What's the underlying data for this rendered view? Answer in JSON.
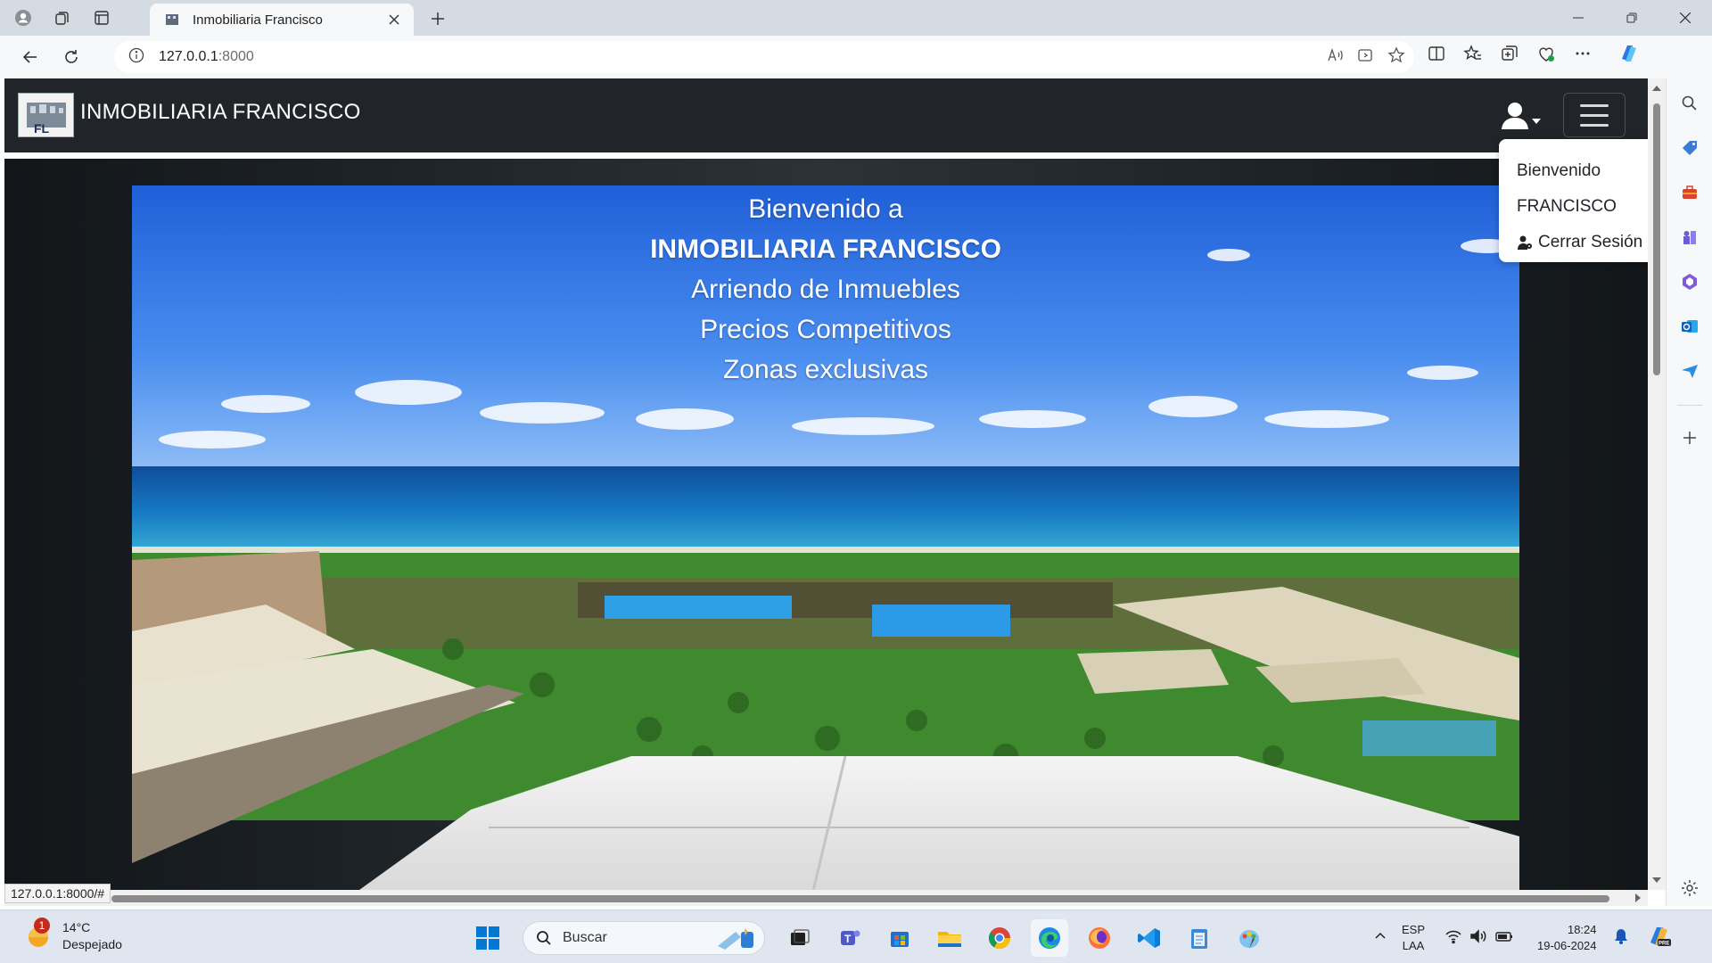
{
  "browser": {
    "tab_title": "Inmobiliaria Francisco",
    "url_host": "127.0.0.1",
    "url_port": ":8000",
    "status_url": "127.0.0.1:8000/#"
  },
  "navbar": {
    "brand": "INMOBILIARIA FRANCISCO"
  },
  "dropdown": {
    "welcome": "Bienvenido",
    "user": "FRANCISCO",
    "logout": "Cerrar Sesión"
  },
  "hero": {
    "line1": "Bienvenido a",
    "line2": "INMOBILIARIA FRANCISCO",
    "line3": "Arriendo de Inmuebles",
    "line4": "Precios Competitivos",
    "line5": "Zonas exclusivas"
  },
  "taskbar": {
    "weather_temp": "14°C",
    "weather_desc": "Despejado",
    "weather_badge": "1",
    "search_placeholder": "Buscar",
    "lang_line1": "ESP",
    "lang_line2": "LAA",
    "time": "18:24",
    "date": "19-06-2024"
  },
  "colors": {
    "navbar": "#212529",
    "accent": "#0078d4"
  }
}
